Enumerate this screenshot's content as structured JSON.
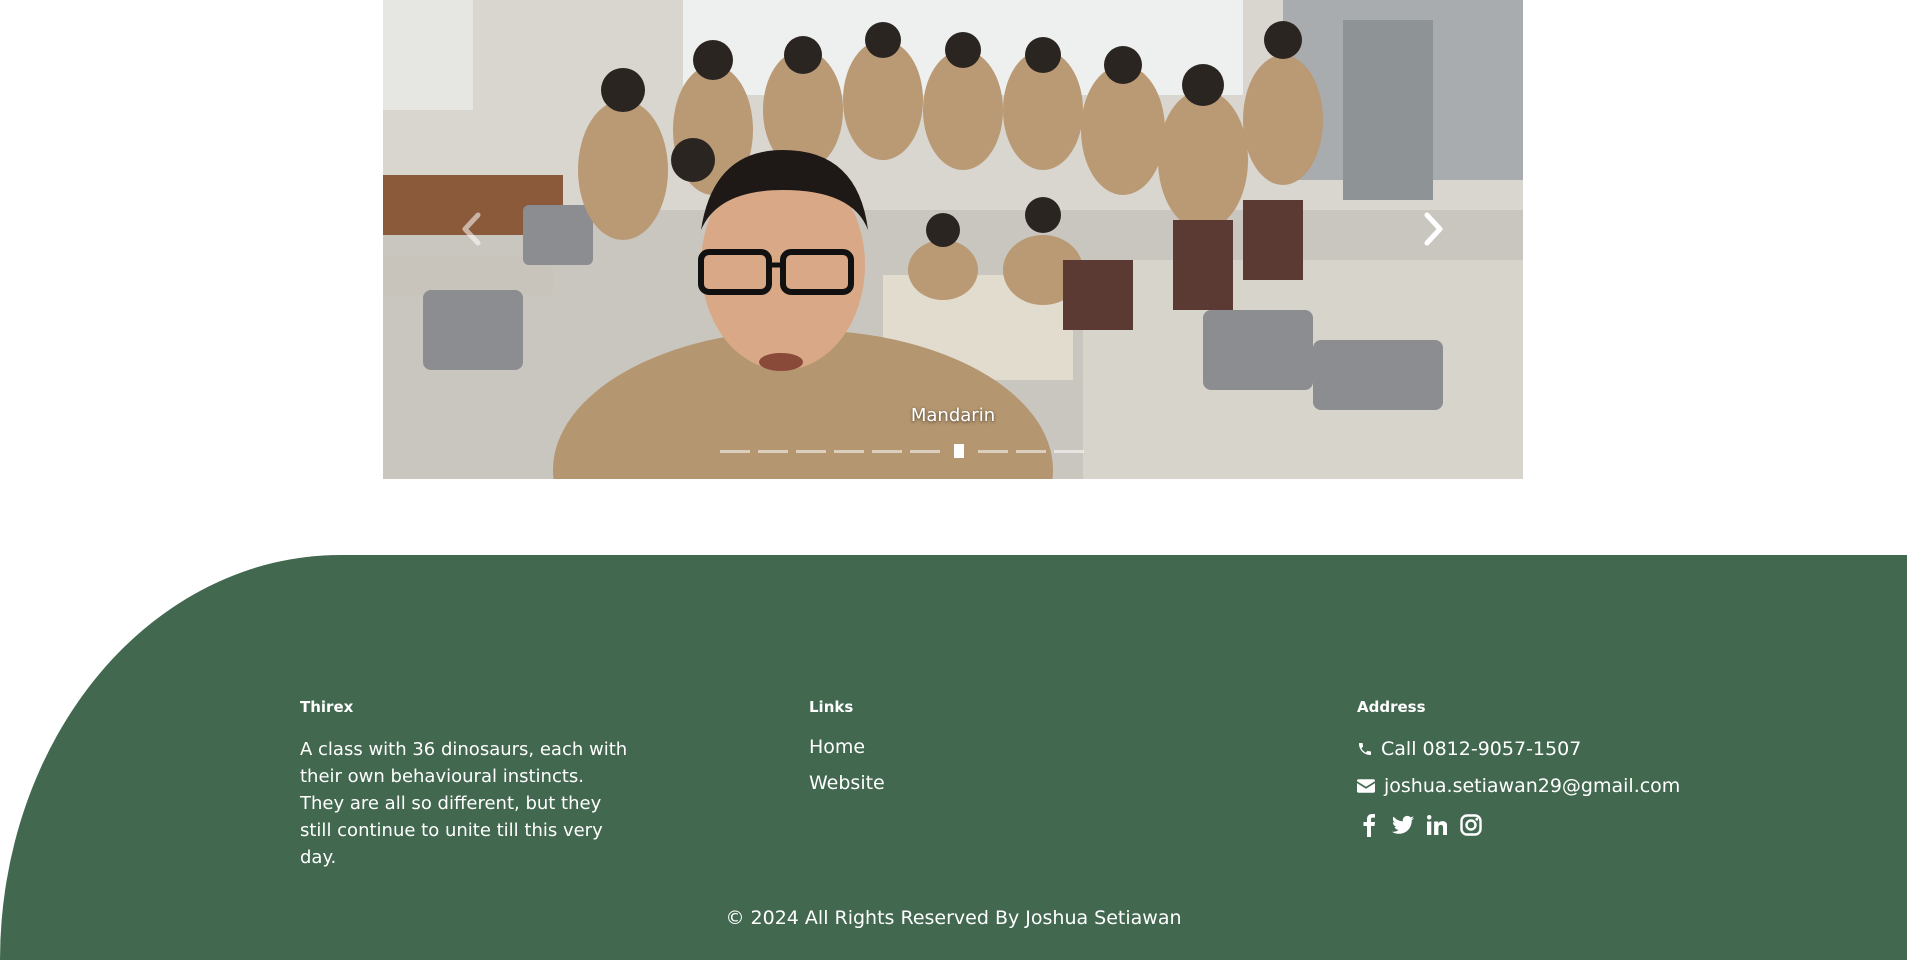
{
  "carousel": {
    "caption": "Mandarin",
    "prev_icon": "chevron-left-icon",
    "next_icon": "chevron-right-icon",
    "slide_count": 10,
    "active_index": 6
  },
  "footer": {
    "background_color": "#426850",
    "about": {
      "heading": "Thirex",
      "text": "A class with 36 dinosaurs, each with their own behavioural instincts. They are all so different, but they still continue to unite till this very day."
    },
    "links": {
      "heading": "Links",
      "items": [
        {
          "label": "Home"
        },
        {
          "label": "Website"
        }
      ]
    },
    "address": {
      "heading": "Address",
      "phone": "Call 0812-9057-1507",
      "email": "joshua.setiawan29@gmail.com",
      "phone_icon": "phone-icon",
      "email_icon": "envelope-icon",
      "socials": [
        "facebook-icon",
        "twitter-icon",
        "linkedin-icon",
        "instagram-icon"
      ]
    },
    "copyright": "© 2024 All Rights Reserved By Joshua Setiawan"
  }
}
